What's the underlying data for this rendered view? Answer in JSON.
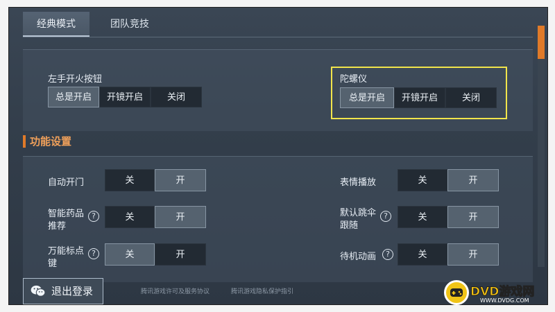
{
  "tabs": [
    {
      "label": "经典模式",
      "active": true
    },
    {
      "label": "团队竞技",
      "active": false
    }
  ],
  "fire_button": {
    "label": "左手开火按钮",
    "options": [
      "总是开启",
      "开镜开启",
      "关闭"
    ],
    "selected": "总是开启"
  },
  "gyroscope": {
    "label": "陀螺仪",
    "options": [
      "总是开启",
      "开镜开启",
      "关闭"
    ],
    "selected": "总是开启"
  },
  "section": {
    "title": "功能设置"
  },
  "toggles": {
    "off_label": "关",
    "on_label": "开",
    "auto_door": {
      "label": "自动开门",
      "selected": "开"
    },
    "smart_med_line1": "智能药品",
    "smart_med_line2": "推荐",
    "smart_med": {
      "selected": "开"
    },
    "marker_line1": "万能标点",
    "marker_line2": "键",
    "marker": {
      "selected": "关"
    },
    "emote": {
      "label": "表情播放",
      "selected": "开"
    },
    "parachute_line1": "默认跳伞",
    "parachute_line2": "跟随",
    "parachute": {
      "selected": "开"
    },
    "idle_anim": {
      "label": "待机动画",
      "selected": "开"
    }
  },
  "help_icon": "?",
  "logout": {
    "label": "退出登录"
  },
  "footer": {
    "link1": "腾讯游戏许可及服务协议",
    "link2": "腾讯游戏隐私保护指引"
  },
  "watermark": {
    "brand": "DVD游戏网",
    "url": "WWW.DVDG.COM"
  },
  "colors": {
    "accent": "#e07a29",
    "highlight": "#f2e54b"
  }
}
